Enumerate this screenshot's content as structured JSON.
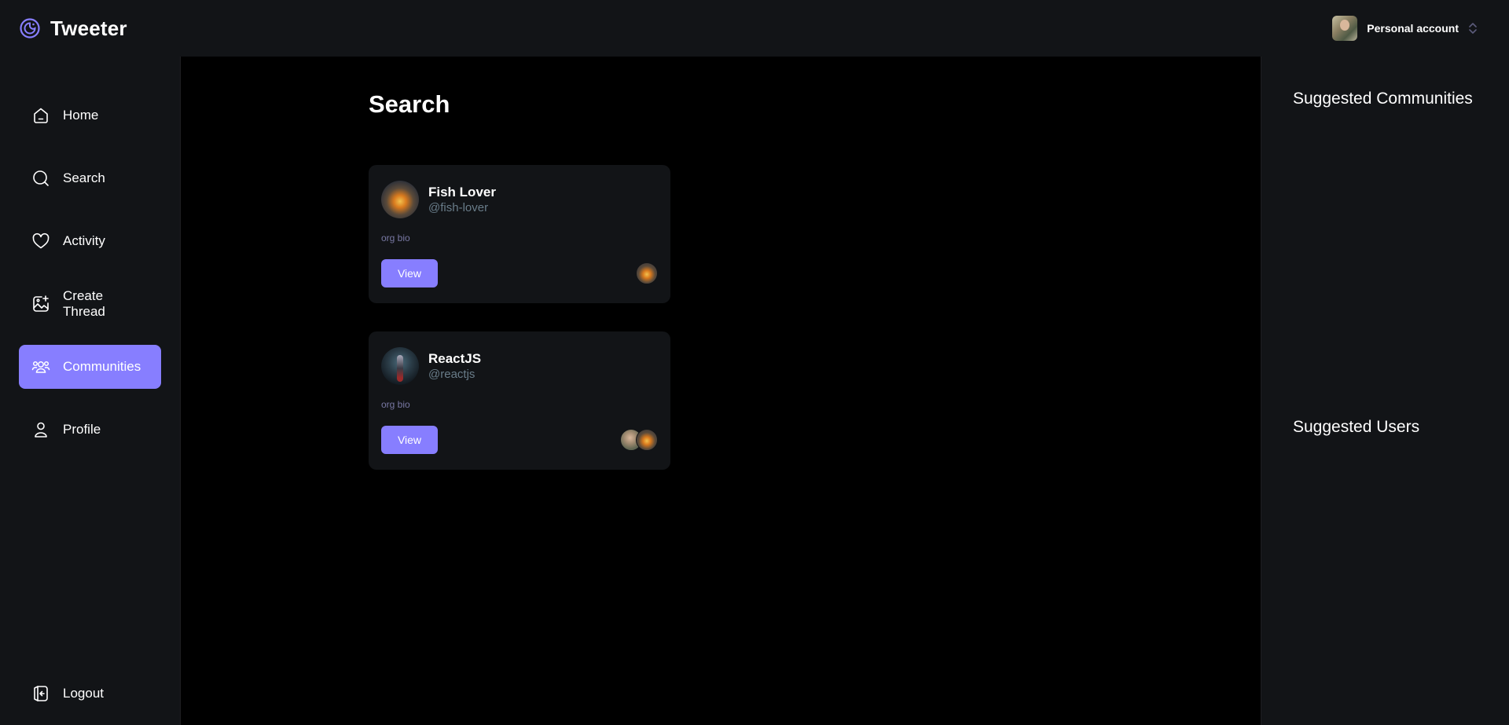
{
  "app": {
    "name": "Tweeter"
  },
  "account": {
    "label": "Personal account",
    "chevron_icon": "chevron-up-down-icon"
  },
  "sidebar": {
    "items": [
      {
        "label": "Home",
        "icon": "home-icon",
        "active": false
      },
      {
        "label": "Search",
        "icon": "search-icon",
        "active": false
      },
      {
        "label": "Activity",
        "icon": "heart-icon",
        "active": false
      },
      {
        "label": "Create Thread",
        "icon": "create-image-icon",
        "active": false
      },
      {
        "label": "Communities",
        "icon": "communities-icon",
        "active": true
      },
      {
        "label": "Profile",
        "icon": "user-icon",
        "active": false
      }
    ],
    "logout": {
      "label": "Logout",
      "icon": "logout-icon"
    }
  },
  "main": {
    "title": "Search",
    "communities": [
      {
        "name": "Fish Lover",
        "handle": "@fish-lover",
        "bio": "org bio",
        "button": "View",
        "member_count_shown": 1
      },
      {
        "name": "ReactJS",
        "handle": "@reactjs",
        "bio": "org bio",
        "button": "View",
        "member_count_shown": 2
      }
    ]
  },
  "right": {
    "suggested_communities": "Suggested Communities",
    "suggested_users": "Suggested Users"
  },
  "colors": {
    "accent": "#877eff",
    "panel": "#121417",
    "background": "#000000",
    "handle": "#697c89"
  }
}
